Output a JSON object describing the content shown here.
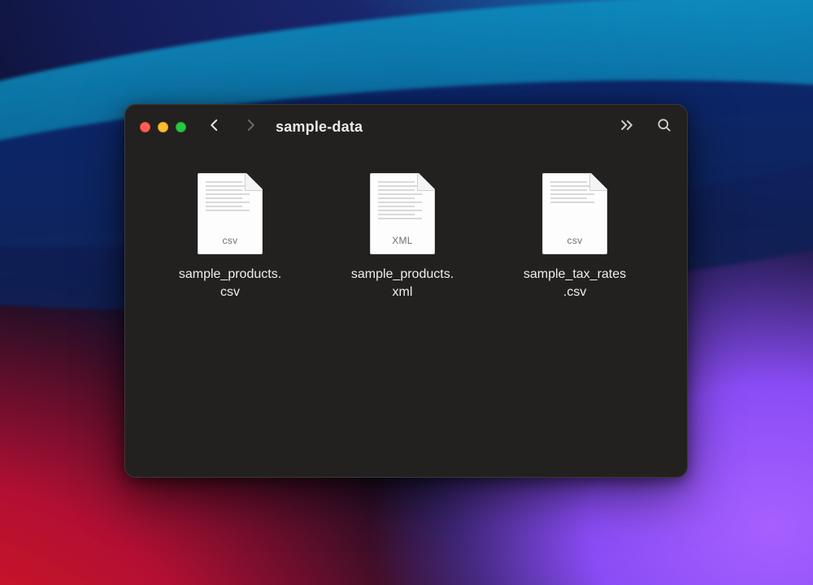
{
  "window": {
    "title": "sample-data",
    "traffic_lights": {
      "close": "#ff5f57",
      "minimize": "#febc2e",
      "zoom": "#28c840"
    }
  },
  "files": [
    {
      "name_line1": "sample_products.",
      "name_line2": "csv",
      "type_badge": "csv"
    },
    {
      "name_line1": "sample_products.",
      "name_line2": "xml",
      "type_badge": "XML"
    },
    {
      "name_line1": "sample_tax_rates",
      "name_line2": ".csv",
      "type_badge": "csv"
    }
  ]
}
